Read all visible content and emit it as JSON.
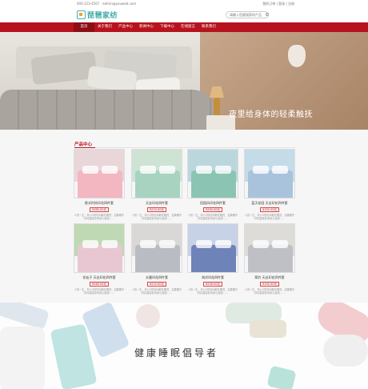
{
  "topbar": {
    "contact": "400-123-4567  ·  admin@youweb.com",
    "links": "我的订单 | 登录 | 注册"
  },
  "header": {
    "logo_text": "琵琶家纺",
    "search_placeholder": "请输入您要搜索的产品"
  },
  "nav": {
    "items": [
      "首页",
      "关于我们",
      "产品中心",
      "新闻中心",
      "下载中心",
      "在线留言",
      "联系我们"
    ]
  },
  "banner": {
    "slogan": "夜里给身体的轻柔触抚",
    "dot_count": 3
  },
  "products": {
    "section_title": "产品中心",
    "items": [
      {
        "name": "欧式时尚印花四件套",
        "price": "¥365.00元",
        "desc": "人的一生，有1/3的时间都在睡觉，如果睡不好将直接影响身心健康……",
        "colors": [
          "#e9d6d8",
          "#f2b7c1"
        ]
      },
      {
        "name": "天丝印花四件套",
        "price": "¥210.00元",
        "desc": "人的一生，有1/3的时间都在睡觉，如果睡不好将直接影响身心健康……",
        "colors": [
          "#cfe3d4",
          "#a7d3c0"
        ]
      },
      {
        "name": "田园风印花四件套",
        "price": "¥290.00元",
        "desc": "人的一生，有1/3的时间都在睡觉，如果睡不好将直接影响身心健康……",
        "colors": [
          "#bcd6de",
          "#8bc4b2"
        ]
      },
      {
        "name": "蓝天花园 天丝印花四件套",
        "price": "¥192.00元",
        "desc": "人的一生，有1/3的时间都在睡觉，如果睡不好将直接影响身心健康……",
        "colors": [
          "#c4dbe8",
          "#a9c3dc"
        ]
      },
      {
        "name": "花仙子 天丝印花四件套",
        "price": "¥260.00元",
        "desc": "人的一生，有1/3的时间都在睡觉，如果睡不好将直接影响身心健康……",
        "colors": [
          "#bfd9b5",
          "#e9c7d2"
        ]
      },
      {
        "name": "水墨印花四件套",
        "price": "¥210.00元",
        "desc": "人的一生，有1/3的时间都在睡觉，如果睡不好将直接影响身心健康……",
        "colors": [
          "#dad8d6",
          "#b9bcc2"
        ]
      },
      {
        "name": "海洋印花四件套",
        "price": "¥228.00元",
        "desc": "人的一生，有1/3的时间都在睡觉，如果睡不好将直接影响身心健康……",
        "colors": [
          "#c7d2e6",
          "#6e84b8"
        ]
      },
      {
        "name": "简约 天丝印花四件套",
        "price": "¥192.00元",
        "desc": "人的一生，有1/3的时间都在睡觉，如果睡不好将直接影响身心健康……",
        "colors": [
          "#dddcd9",
          "#bfc0c6"
        ]
      }
    ]
  },
  "bottom": {
    "slogan": "健康睡眠倡导者"
  },
  "colors": {
    "brand_red": "#b7131e",
    "logo_teal": "#3aa8a4"
  }
}
